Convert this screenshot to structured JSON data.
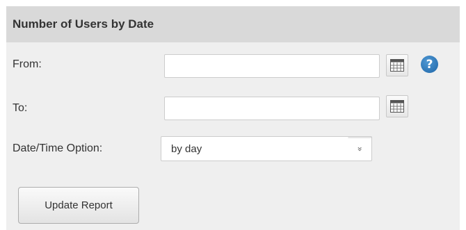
{
  "panel": {
    "title": "Number of Users by Date"
  },
  "form": {
    "from_label": "From:",
    "from_value": "",
    "to_label": "To:",
    "to_value": "",
    "date_option_label": "Date/Time Option:",
    "date_option_selected": "by day",
    "help_glyph": "?",
    "update_button_label": "Update Report"
  },
  "icons": {
    "calendar": "calendar-icon",
    "help": "help-icon",
    "dropdown": "double-chevron-down-icon"
  },
  "colors": {
    "header_bg": "#d9d9d9",
    "panel_bg": "#efefef",
    "help_icon": "#2a6fb0"
  }
}
